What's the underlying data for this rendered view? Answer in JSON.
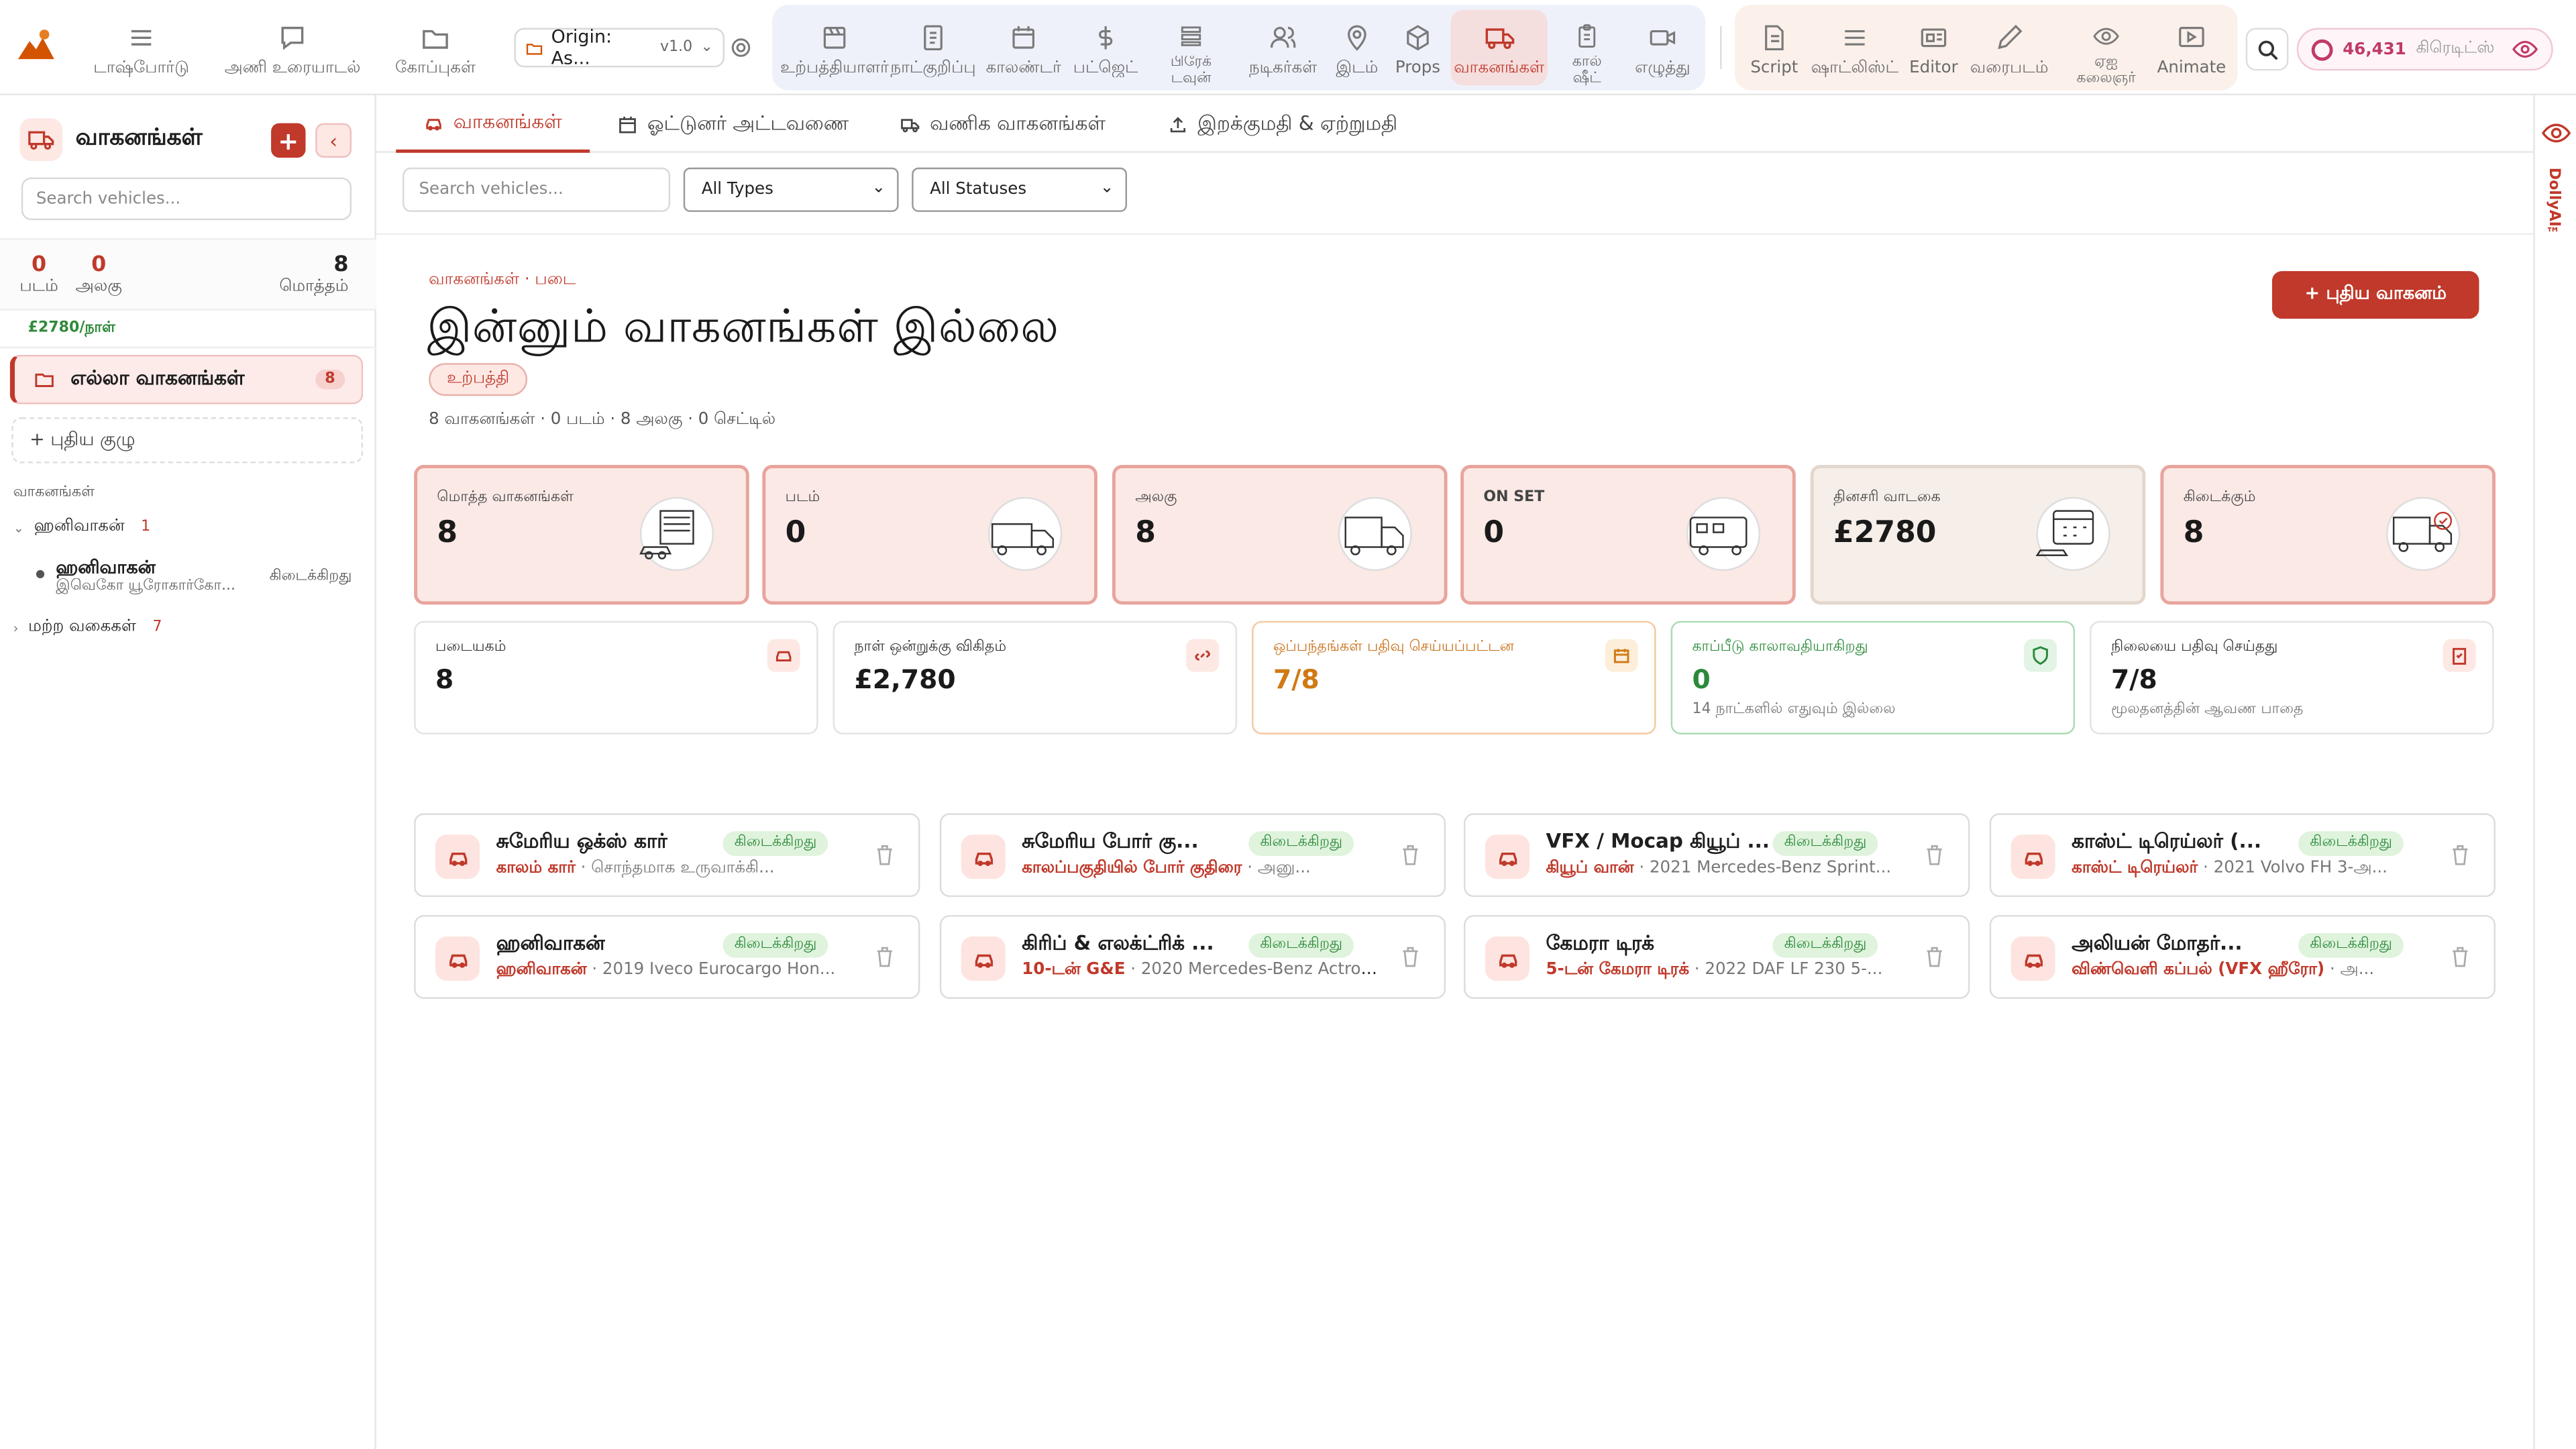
{
  "nav": {
    "left": [
      {
        "label": "டாஷ்போர்டு",
        "icon": "menu-icon"
      },
      {
        "label": "அணி உரையாடல்",
        "icon": "chat-icon"
      },
      {
        "label": "கோப்புகள்",
        "icon": "folder-icon"
      }
    ],
    "project": {
      "name": "Origin: As...",
      "version": "v1.0"
    },
    "group1": [
      {
        "label": "உற்பத்தியாளர்",
        "icon": "clapper-icon"
      },
      {
        "label": "நாட்குறிப்பு",
        "icon": "notebook-icon"
      },
      {
        "label": "காலண்டர்",
        "icon": "calendar-icon"
      },
      {
        "label": "பட்ஜெட்",
        "icon": "dollar-icon"
      },
      {
        "label": "பிரேக் டவுன்",
        "icon": "list-icon"
      },
      {
        "label": "நடிகர்கள்",
        "icon": "people-icon"
      },
      {
        "label": "இடம்",
        "icon": "pin-icon"
      },
      {
        "label": "Props",
        "icon": "cube-icon"
      },
      {
        "label": "வாகனங்கள்",
        "icon": "truck-icon"
      },
      {
        "label": "கால் ஷீட்",
        "icon": "clipboard-icon"
      },
      {
        "label": "எழுத்து",
        "icon": "camera-icon"
      }
    ],
    "group2": [
      {
        "label": "Script",
        "icon": "script-icon"
      },
      {
        "label": "ஷாட்லிஸ்ட்",
        "icon": "shotlist-icon"
      },
      {
        "label": "Editor",
        "icon": "editor-icon"
      },
      {
        "label": "வரைபடம்",
        "icon": "pencil-icon"
      },
      {
        "label": "ஏஐ கலைஞர்",
        "icon": "eye-icon"
      },
      {
        "label": "Animate",
        "icon": "play-icon"
      }
    ],
    "credits": {
      "amount": "46,431",
      "unit": "கிரெடிட்ஸ்"
    }
  },
  "sidebar": {
    "title": "வாகனங்கள்",
    "search_placeholder": "Search vehicles...",
    "stats": [
      {
        "value": "0",
        "label": "படம்"
      },
      {
        "value": "0",
        "label": "அலகு"
      },
      {
        "value": "8",
        "label": "மொத்தம்"
      }
    ],
    "rate": "£2780/நாள்",
    "all_label": "எல்லா வாகனங்கள்",
    "all_count": "8",
    "new_group": "+  புதிய குழு",
    "section": "வாகனங்கள்",
    "tree": [
      {
        "label": "ஹனிவாகன்",
        "count": "1"
      },
      {
        "label": "மற்ற வகைகள்",
        "count": "7"
      }
    ],
    "tree_item": {
      "title": "ஹனிவாகன்",
      "sub": "இவெகோ யூரோகார்கோ...",
      "status": "கிடைக்கிறது"
    }
  },
  "tabs": [
    {
      "label": "வாகனங்கள்"
    },
    {
      "label": "ஓட்டுனர் அட்டவணை"
    },
    {
      "label": "வணிக வாகனங்கள்"
    },
    {
      "label": "இறக்குமதி & ஏற்றுமதி"
    }
  ],
  "filters": {
    "search_placeholder": "Search vehicles...",
    "type": "All Types",
    "status": "All Statuses"
  },
  "page": {
    "breadcrumb": "வாகனங்கள் · படை",
    "title": "இன்னும் வாகனங்கள் இல்லை",
    "pill": "உற்பத்தி",
    "summary": "8 வாகனங்கள் · 0 படம் · 8 அலகு · 0 செட்டில்",
    "new_button": "+ புதிய வாகனம்"
  },
  "stat_cards": [
    {
      "label": "மொத்த வாகனங்கள்",
      "value": "8"
    },
    {
      "label": "படம்",
      "value": "0"
    },
    {
      "label": "அலகு",
      "value": "8"
    },
    {
      "label": "ON SET",
      "value": "0"
    },
    {
      "label": "தினசரி வாடகை",
      "value": "£2780"
    },
    {
      "label": "கிடைக்கும்",
      "value": "8"
    }
  ],
  "info_cards": [
    {
      "label": "படையகம்",
      "value": "8",
      "sub": ""
    },
    {
      "label": "நாள் ஒன்றுக்கு விகிதம்",
      "value": "£2,780",
      "sub": ""
    },
    {
      "label": "ஒப்பந்தங்கள் பதிவு செய்யப்பட்டன",
      "value": "7/8",
      "sub": ""
    },
    {
      "label": "காப்பீடு காலாவதியாகிறது",
      "value": "0",
      "sub": "14 நாட்களில் எதுவும் இல்லை"
    },
    {
      "label": "நிலையை பதிவு செய்தது",
      "value": "7/8",
      "sub": "மூலதனத்தின் ஆவண பாதை"
    }
  ],
  "vehicles": [
    {
      "name": "சுமேரிய ஒக்ஸ் கார்",
      "status": "கிடைக்கிறது",
      "type": "காலம் கார்",
      "desc": "சொந்தமாக உருவாக்கி..."
    },
    {
      "name": "சுமேரிய போர் கு...",
      "status": "கிடைக்கிறது",
      "type": "காலப்பகுதியில் போர் குதிரை",
      "desc": "அனு..."
    },
    {
      "name": "VFX / Mocap கியூப் ...",
      "status": "கிடைக்கிறது",
      "type": "கியூப் வான்",
      "desc": "2021 Mercedes-Benz Sprint..."
    },
    {
      "name": "காஸ்ட் டிரெய்லர் (...",
      "status": "கிடைக்கிறது",
      "type": "காஸ்ட் டிரெய்லர்",
      "desc": "2021 Volvo FH 3-அ..."
    },
    {
      "name": "ஹனிவாகன்",
      "status": "கிடைக்கிறது",
      "type": "ஹனிவாகன்",
      "desc": "2019 Iveco Eurocargo Hon..."
    },
    {
      "name": "கிரிப் & எலக்ட்ரிக் ...",
      "status": "கிடைக்கிறது",
      "type": "10-டன் G&E",
      "desc": "2020 Mercedes-Benz Actros 1..."
    },
    {
      "name": "கேமரா டிரக்",
      "status": "கிடைக்கிறது",
      "type": "5-டன் கேமரா டிரக்",
      "desc": "2022 DAF LF 230 5-..."
    },
    {
      "name": "அலியன் மோதர்...",
      "status": "கிடைக்கிறது",
      "type": "விண்வெளி கப்பல் (VFX ஹீரோ)",
      "desc": "அ..."
    }
  ],
  "rail": {
    "label": "DollyAI™"
  }
}
